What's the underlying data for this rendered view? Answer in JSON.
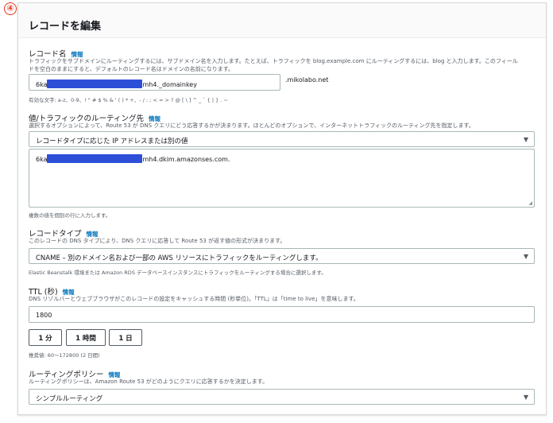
{
  "step_marker": "④",
  "panel": {
    "title": "レコードを編集"
  },
  "info_label": "情報",
  "record_name": {
    "label": "レコード名",
    "description_line1": "トラフィックをサブドメインにルーティングするには、サブドメイン名を入力します。たとえば、トラフィックを blog.example.com にルーティングするには、blog と入力します。このフィール",
    "description_line2": "ドを空白のままにすると、デフォルトのレコード名はドメインの名前になります。",
    "value_prefix": "6ka",
    "value_suffix": "mh4._domainkey",
    "domain_suffix": ".mikolabo.net",
    "allowed_chars": "有効な文字: a-z、0-9、! \" # $ % & ' ( ) * +、- / : ; < = > ? @ [ \\ ] ^ _ ` { | } . ~"
  },
  "value": {
    "label": "値/トラフィックのルーティング先",
    "description": "選択するオプションによって、Route 53 が DNS クエリにどう応答するかが決まります。ほとんどのオプションで、インターネットトラフィックのルーティング先を指定します。",
    "select_value": "レコードタイプに応じた IP アドレスまたは別の値",
    "text_prefix": "6ka",
    "text_suffix": "mh4.dkim.amazonses.com.",
    "hint": "複数の値を個別の行に入力します。"
  },
  "record_type": {
    "label": "レコードタイプ",
    "description": "このレコードの DNS タイプにより、DNS クエリに応答して Route 53 が返す値の形式が決まります。",
    "select_value": "CNAME – 別のドメイン名および一部の AWS リソースにトラフィックをルーティングします。",
    "hint": "Elastic Beanstalk 環境または Amazon RDS データベースインスタンスにトラフィックをルーティングする場合に選択します。"
  },
  "ttl": {
    "label": "TTL (秒)",
    "description": "DNS リゾルバーとウェブブラウザがこのレコードの設定をキャッシュする時間 (秒単位)。「TTL」は「time to live」を意味します。",
    "value": "1800",
    "buttons": [
      "1 分",
      "1 時間",
      "1 日"
    ],
    "recommended": "推奨値: 60～172800 (2 日間)"
  },
  "routing_policy": {
    "label": "ルーティングポリシー",
    "description": "ルーティングポリシーは、Amazon Route 53 がどのようにクエリに応答するかを決定します。",
    "select_value": "シンプルルーティング"
  },
  "colors": {
    "accent": "#e8361b",
    "link": "#0073bb",
    "redaction": "#2d4fd8"
  },
  "icons": {
    "dropdown": "caret-down-icon",
    "resize": "resize-handle-icon"
  }
}
